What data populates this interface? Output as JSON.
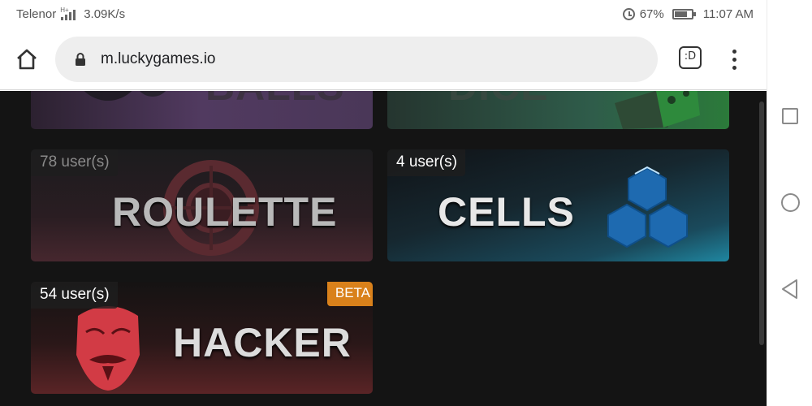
{
  "status_bar": {
    "carrier": "Telenor",
    "network_type": "H+",
    "speed": "3.09K/s",
    "battery": "67%",
    "time": "11:07 AM"
  },
  "browser": {
    "url": "m.luckygames.io",
    "tab_switcher_label": ":D"
  },
  "games": [
    {
      "title": "BALLS"
    },
    {
      "title": "DICE"
    },
    {
      "title": "ROULETTE",
      "users": "78 user(s)"
    },
    {
      "title": "CELLS",
      "users": "4 user(s)"
    },
    {
      "title": "HACKER",
      "users": "54 user(s)",
      "badge": "BETA"
    }
  ],
  "colors": {
    "beta_badge": "#d9811b",
    "page_background": "#141414",
    "cells_icon": "#1e6ab0",
    "hacker_mask": "#d23b45"
  }
}
